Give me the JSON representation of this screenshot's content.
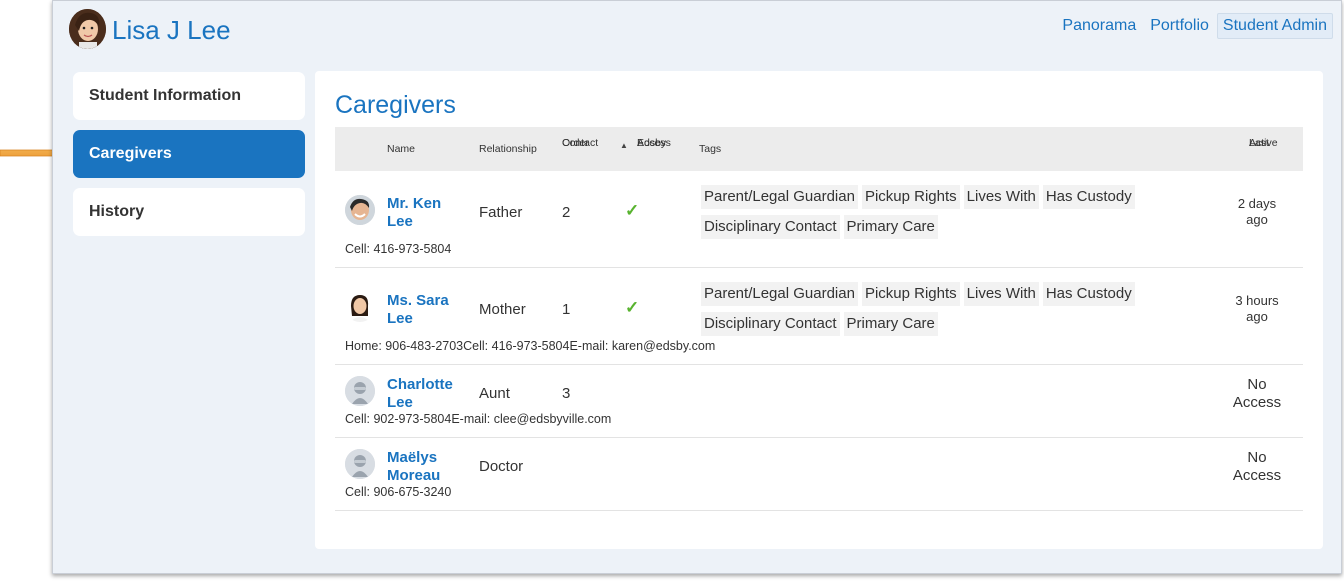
{
  "student": {
    "name": "Lisa J Lee"
  },
  "top_nav": [
    {
      "label": "Panorama",
      "active": false
    },
    {
      "label": "Portfolio",
      "active": false
    },
    {
      "label": "Student Admin",
      "active": true
    }
  ],
  "sidebar": {
    "items": [
      {
        "label": "Student Information",
        "active": false
      },
      {
        "label": "Caregivers",
        "active": true
      },
      {
        "label": "History",
        "active": false
      }
    ]
  },
  "section_title": "Caregivers",
  "table": {
    "headers": {
      "name": "Name",
      "relationship": "Relationship",
      "contact_order_1": "Contact",
      "contact_order_2": "Order",
      "edsby_access_1": "Edsby",
      "edsby_access_2": "Access",
      "tags": "Tags",
      "last_active_1": "Last",
      "last_active_2": "Active"
    },
    "rows": [
      {
        "name_1": "Mr. Ken",
        "name_2": "Lee",
        "relationship": "Father",
        "contact_order": "2",
        "edsby_access": "✓",
        "tags": [
          "Parent/Legal Guardian",
          "Pickup Rights",
          "Lives With",
          "Has Custody",
          "Disciplinary Contact",
          "Primary Care"
        ],
        "last_active_1": "2 days",
        "last_active_2": "ago",
        "contact": "Cell: 416-973-5804"
      },
      {
        "name_1": "Ms. Sara",
        "name_2": "Lee",
        "relationship": "Mother",
        "contact_order": "1",
        "edsby_access": "✓",
        "tags": [
          "Parent/Legal Guardian",
          "Pickup Rights",
          "Lives With",
          "Has Custody",
          "Disciplinary Contact",
          "Primary Care"
        ],
        "last_active_1": "3 hours",
        "last_active_2": "ago",
        "contact": "Home: 906-483-2703Cell: 416-973-5804E-mail: karen@edsby.com"
      },
      {
        "name_1": "Charlotte",
        "name_2": "Lee",
        "relationship": "Aunt",
        "contact_order": "3",
        "edsby_access": "",
        "tags": [],
        "last_active_1": "No",
        "last_active_2": "Access",
        "contact": "Cell: 902-973-5804E-mail: clee@edsbyville.com"
      },
      {
        "name_1": "Maëlys",
        "name_2": "Moreau",
        "relationship": "Doctor",
        "contact_order": "",
        "edsby_access": "",
        "tags": [],
        "last_active_1": "No",
        "last_active_2": "Access",
        "contact": "Cell: 906-675-3240"
      }
    ]
  },
  "icons": {
    "pointer_arrow": "arrow-right-icon",
    "checkmark": "check-icon",
    "sort": "sort-asc-icon",
    "default_avatar": "person-avatar-icon"
  },
  "colors": {
    "accent": "#1a74c0",
    "arrow": "#f0a33b",
    "check": "#58b32f",
    "page_bg": "#edf2f8"
  }
}
